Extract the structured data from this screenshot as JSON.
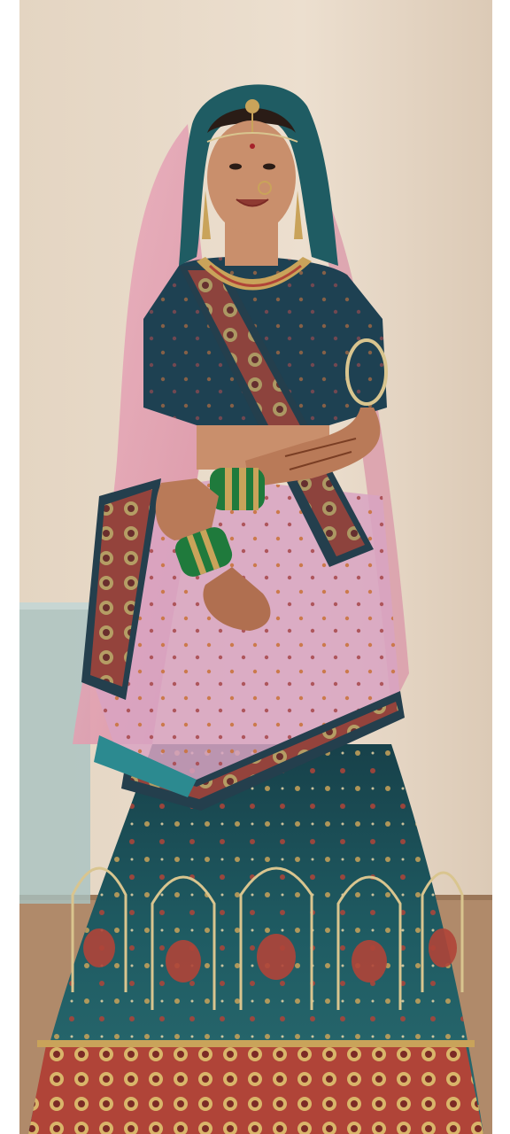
{
  "image": {
    "alt": "",
    "subject": "bride-in-lehenga",
    "palette": {
      "wall": "#e9dccb",
      "wall_shadow": "#d7c6b2",
      "floor": "#b08a6a",
      "glass_panel": "#a9c3c2",
      "skirt_teal": "#1f5c63",
      "skirt_dark": "#173f47",
      "border_red": "#b04438",
      "gold": "#c9a35a",
      "dupatta_pink": "#e7a3b4",
      "blouse_navy": "#1e4152",
      "skin": "#c98f6c",
      "bangles_green": "#1f7a3c",
      "hair": "#2a1c16"
    }
  }
}
